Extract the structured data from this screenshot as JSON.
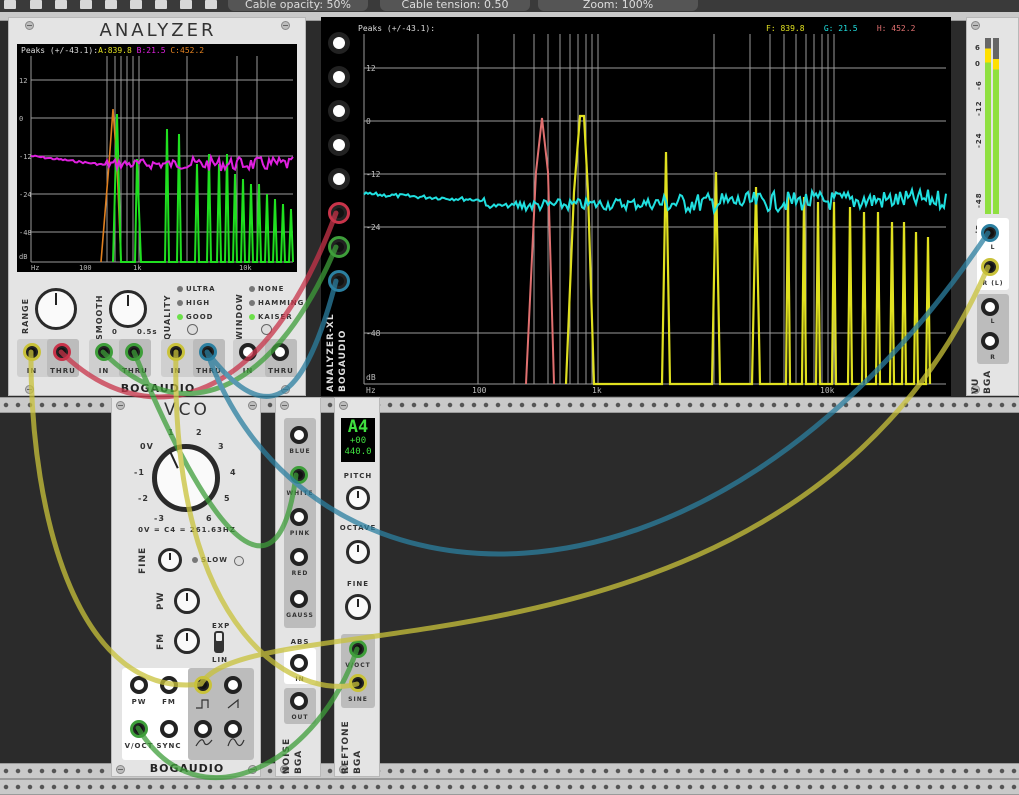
{
  "toolbar": {
    "cable_opacity": "Cable opacity: 50%",
    "cable_tension": "Cable tension: 0.50",
    "zoom": "Zoom: 100%"
  },
  "analyzer": {
    "title": "ANALYZER",
    "peaks_label": "Peaks (+/-43.1):",
    "peak_a_label": "A:",
    "peak_a": "839.8",
    "peak_b_label": "B:",
    "peak_b": "21.5",
    "peak_c_label": "C:",
    "peak_c": "452.2",
    "y_ticks": [
      "12",
      "0",
      "-12",
      "-24",
      "-48",
      "dB"
    ],
    "x_ticks": [
      "Hz",
      "100",
      "1k",
      "10k"
    ],
    "range_label": "RANGE",
    "smooth_label": "SMOOTH",
    "smooth_min": "0",
    "smooth_max": "0.5s",
    "quality_label": "QUALITY",
    "quality_options": [
      "ULTRA",
      "HIGH",
      "GOOD"
    ],
    "window_label": "WINDOW",
    "window_options": [
      "NONE",
      "HAMMING",
      "KAISER"
    ],
    "ports": [
      "IN",
      "THRU",
      "IN",
      "THRU",
      "IN",
      "THRU",
      "IN",
      "THRU"
    ],
    "brand": "BOGAUDIO"
  },
  "analyzer_xl": {
    "peaks_label": "Peaks (+/-43.1):",
    "peak_f_label": "F:",
    "peak_f": "839.8",
    "peak_g_label": "G:",
    "peak_g": "21.5",
    "peak_h_label": "H:",
    "peak_h": "452.2",
    "y_ticks": [
      "12",
      "0",
      "-12",
      "-24",
      "-48",
      "dB"
    ],
    "x_ticks": [
      "Hz",
      "100",
      "1k",
      "10k"
    ],
    "side_label": "ANALYZER-XL",
    "side_brand": "BOGAUDIO"
  },
  "vu": {
    "scale": [
      "6",
      "0",
      "-6",
      "-12",
      "-24",
      "-48",
      "dB"
    ],
    "ports": [
      "L",
      "R (L)",
      "L",
      "R"
    ],
    "side_label": "VU",
    "side_brand": "BGA"
  },
  "vco": {
    "title": "VCO",
    "freq_ticks": [
      "0V",
      "1",
      "2",
      "3",
      "4",
      "5",
      "6",
      "-1",
      "-2",
      "-3"
    ],
    "freq_caption": "0V = C4 = 261.63HZ",
    "fine_label": "FINE",
    "slow_label": "SLOW",
    "pw_label": "PW",
    "fm_label": "FM",
    "exp_label": "EXP",
    "lin_label": "LIN",
    "ports": [
      "PW",
      "FM",
      "V/OCT",
      "SYNC"
    ],
    "brand": "BOGAUDIO"
  },
  "noise": {
    "outputs": [
      "BLUE",
      "WHITE",
      "PINK",
      "RED",
      "GAUSS"
    ],
    "abs_label": "ABS",
    "abs_in": "IN",
    "abs_out": "OUT",
    "side_label": "NOISE",
    "side_brand": "BGA"
  },
  "reftone": {
    "note": "A4",
    "cents": "+00",
    "freq": "440.0",
    "pitch_label": "PITCH",
    "octave_label": "OCTAVE",
    "fine_label": "FINE",
    "voct_label": "V/OCT",
    "sine_label": "SINE",
    "side_label": "REFTONE",
    "side_brand": "BGA"
  },
  "colors": {
    "cable_yellow": "#c9c23a",
    "cable_red": "#c8344a",
    "cable_green": "#3e9e3a",
    "cable_blue": "#2b7fa0",
    "trace_magenta": "#e020e0",
    "trace_green": "#20e020",
    "trace_orange": "#e08020",
    "trace_cyan": "#20e0e0",
    "trace_yellow": "#e0e020",
    "trace_pink": "#e07070"
  }
}
